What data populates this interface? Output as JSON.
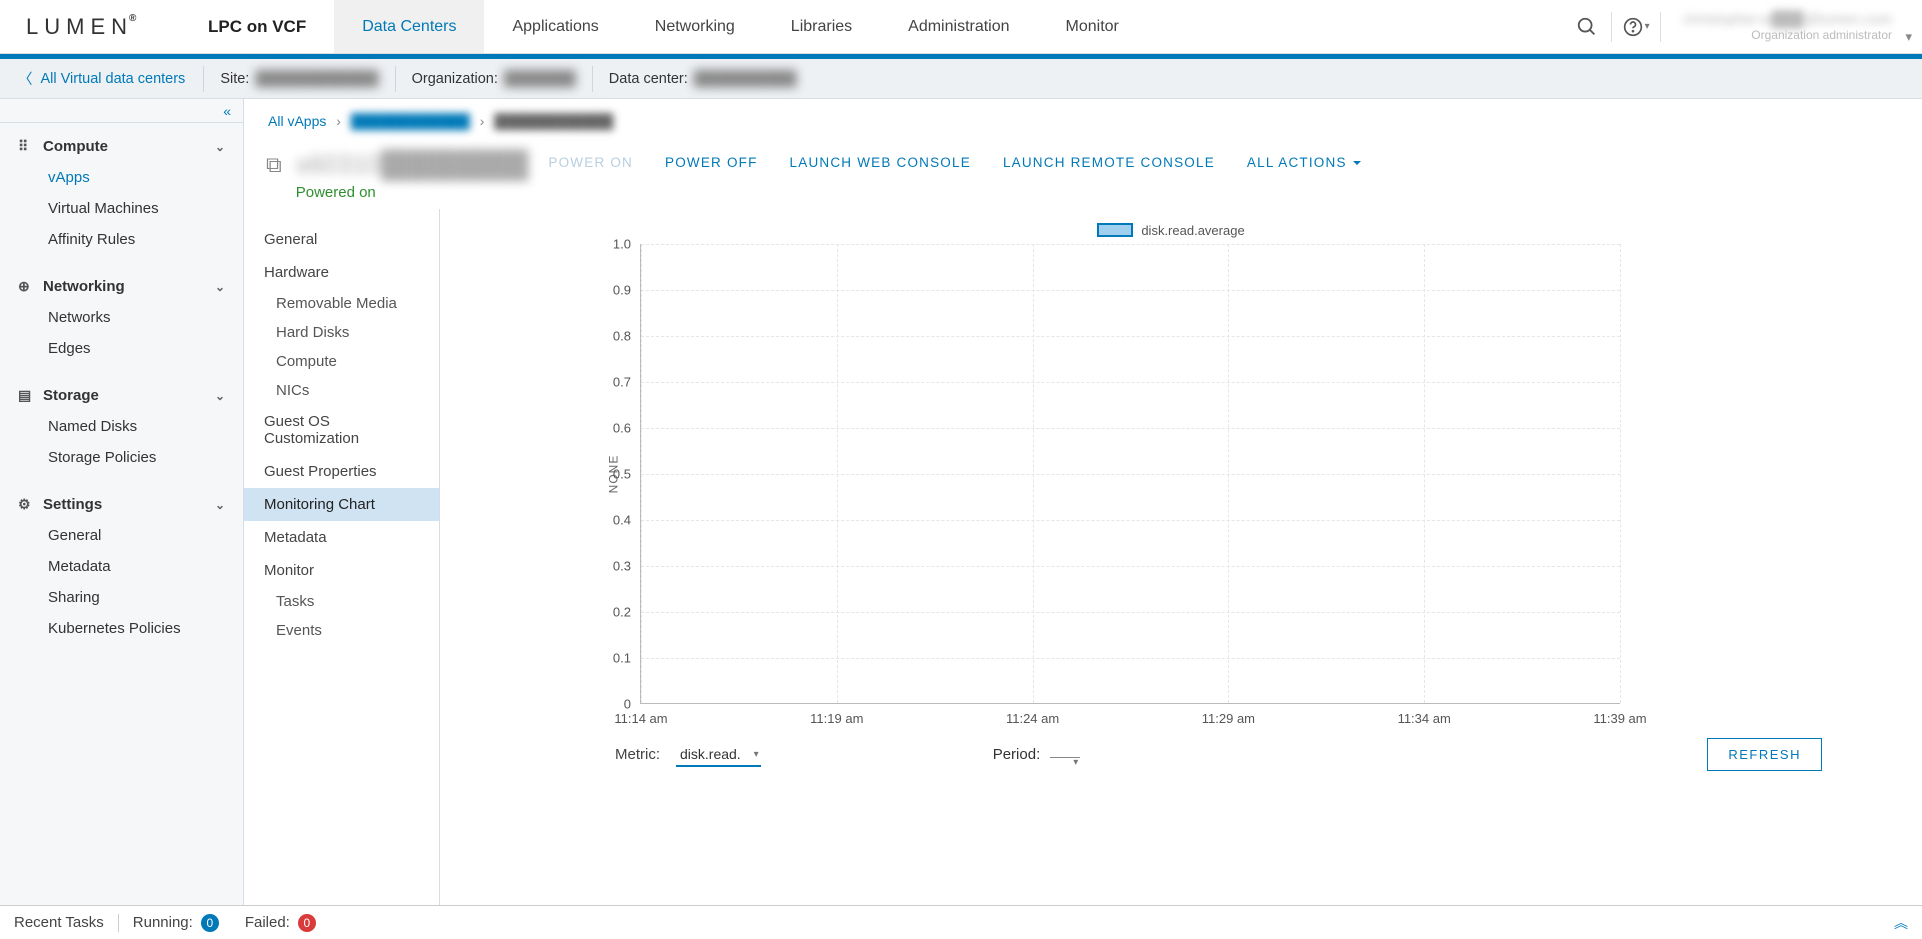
{
  "brand": "LUMEN",
  "product": "LPC on VCF",
  "nav": {
    "tabs": [
      "Data Centers",
      "Applications",
      "Networking",
      "Libraries",
      "Administration",
      "Monitor"
    ],
    "active": "Data Centers"
  },
  "user": {
    "line1": "christopher.w███@lumen.com",
    "line2": "Organization administrator"
  },
  "subheader": {
    "back": "All Virtual data centers",
    "site_lbl": "Site:",
    "site_val": "████████████",
    "org_lbl": "Organization:",
    "org_val": "███████",
    "dc_lbl": "Data center:",
    "dc_val": "██████████"
  },
  "sidebar": {
    "groups": [
      {
        "head": "Compute",
        "items": [
          "vApps",
          "Virtual Machines",
          "Affinity Rules"
        ],
        "sel": "vApps"
      },
      {
        "head": "Networking",
        "items": [
          "Networks",
          "Edges"
        ]
      },
      {
        "head": "Storage",
        "items": [
          "Named Disks",
          "Storage Policies"
        ]
      },
      {
        "head": "Settings",
        "items": [
          "General",
          "Metadata",
          "Sharing",
          "Kubernetes Policies"
        ]
      }
    ]
  },
  "crumbs": {
    "root": "All vApps",
    "mid": "████████████",
    "leaf": "████████████"
  },
  "vm": {
    "title": "s60310████████",
    "status": "Powered on",
    "actions": [
      "POWER ON",
      "POWER OFF",
      "LAUNCH WEB CONSOLE",
      "LAUNCH REMOTE CONSOLE",
      "ALL ACTIONS"
    ],
    "disabled": "POWER ON"
  },
  "innerlist": [
    {
      "t": "item",
      "label": "General"
    },
    {
      "t": "head",
      "label": "Hardware"
    },
    {
      "t": "sub",
      "label": "Removable Media"
    },
    {
      "t": "sub",
      "label": "Hard Disks"
    },
    {
      "t": "sub",
      "label": "Compute"
    },
    {
      "t": "sub",
      "label": "NICs"
    },
    {
      "t": "item",
      "label": "Guest OS Customization"
    },
    {
      "t": "item",
      "label": "Guest Properties"
    },
    {
      "t": "item",
      "label": "Monitoring Chart",
      "sel": true
    },
    {
      "t": "item",
      "label": "Metadata"
    },
    {
      "t": "head",
      "label": "Monitor"
    },
    {
      "t": "sub",
      "label": "Tasks"
    },
    {
      "t": "sub",
      "label": "Events"
    }
  ],
  "chart_data": {
    "type": "line",
    "title": "",
    "legend": "disk.read.average",
    "ylabel": "NONE",
    "ylim": [
      0,
      1.0
    ],
    "yticks": [
      0,
      0.1,
      0.2,
      0.3,
      0.4,
      0.5,
      0.6,
      0.7,
      0.8,
      0.9,
      1.0
    ],
    "x": [
      "11:14 am",
      "11:19 am",
      "11:24 am",
      "11:29 am",
      "11:34 am",
      "11:39 am"
    ],
    "series": [
      {
        "name": "disk.read.average",
        "values": [
          null,
          null,
          null,
          null,
          null,
          null
        ]
      }
    ]
  },
  "controls": {
    "metric_lbl": "Metric:",
    "metric_val": "disk.read.",
    "period_lbl": "Period:",
    "period_val": "",
    "refresh": "REFRESH"
  },
  "footer": {
    "recent": "Recent Tasks",
    "running_lbl": "Running:",
    "running": "0",
    "failed_lbl": "Failed:",
    "failed": "0"
  }
}
